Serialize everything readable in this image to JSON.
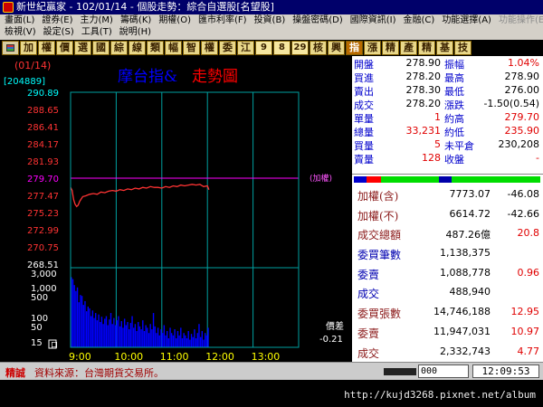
{
  "window": {
    "title": "新世紀贏家 - 102/01/14 - 個股走勢：綜合自選股[名望股]"
  },
  "menu": {
    "row1": [
      "畫面(L)",
      "證券(E)",
      "主力(M)",
      "籌碼(K)",
      "期權(O)",
      "匯市利率(F)",
      "投資(B)",
      "操盤密碼(D)",
      "國際資訊(I)",
      "金融(C)",
      "功能選擇(A)",
      "功能操作(E)"
    ],
    "row1_disabled_index": 11,
    "row2": [
      "檢視(V)",
      "設定(S)",
      "工具(T)",
      "說明(H)"
    ]
  },
  "toolbar": {
    "buttons": [
      {
        "icon": "grid-icon",
        "label": "",
        "kind": "ico"
      },
      {
        "label": "加"
      },
      {
        "label": "權"
      },
      {
        "label": "價"
      },
      {
        "label": "選"
      },
      {
        "label": "國"
      },
      {
        "label": "綜"
      },
      {
        "label": "線"
      },
      {
        "label": "類"
      },
      {
        "label": "幅"
      },
      {
        "label": "智"
      },
      {
        "label": "權"
      },
      {
        "label": "委"
      },
      {
        "label": "江"
      },
      {
        "label": "9",
        "kind": "num"
      },
      {
        "label": "8",
        "kind": "num"
      },
      {
        "label": "29",
        "kind": "num"
      },
      {
        "label": "核"
      },
      {
        "label": "興"
      },
      {
        "label": "指",
        "kind": "hl"
      },
      {
        "label": "漲"
      },
      {
        "label": "精"
      },
      {
        "label": "產"
      },
      {
        "label": "精"
      },
      {
        "label": "基"
      },
      {
        "label": "技"
      }
    ]
  },
  "chart": {
    "date_label": "(01/14)",
    "code_label": "[204889]",
    "stock_name": "摩台指&",
    "chart_title": "走勢圖",
    "ref_label": "(加權)",
    "diff_label": "價差",
    "diff_value": "-0.21",
    "volume_box_label": "口",
    "colors": {
      "up": "#ff3333",
      "down": "#00ff00",
      "flat": "#ffffff",
      "grid": "#00a0a0",
      "price_line": "#ff3333",
      "ref_line": "#ff00ff",
      "volume": "#0000ff"
    }
  },
  "chart_data": {
    "type": "line",
    "price_ticks": [
      290.89,
      288.65,
      286.41,
      284.17,
      281.93,
      279.7,
      277.47,
      275.23,
      272.99,
      270.75,
      268.51
    ],
    "reference": 279.7,
    "ylim": [
      268.51,
      290.89
    ],
    "volume_ticks": [
      "3,000",
      "1,000",
      "500",
      "100",
      "50",
      "15"
    ],
    "volume_ylim": [
      0,
      3000
    ],
    "x_ticks": [
      "9:00",
      "10:00",
      "11:00",
      "12:00",
      "13:00"
    ],
    "x_range_minutes": [
      0,
      300
    ],
    "price_series": [
      [
        0,
        278.5
      ],
      [
        2,
        278.1
      ],
      [
        4,
        276.9
      ],
      [
        6,
        276.3
      ],
      [
        8,
        276.0
      ],
      [
        10,
        276.2
      ],
      [
        12,
        276.7
      ],
      [
        14,
        277.0
      ],
      [
        16,
        277.3
      ],
      [
        20,
        277.4
      ],
      [
        25,
        277.6
      ],
      [
        30,
        277.7
      ],
      [
        35,
        277.6
      ],
      [
        40,
        277.9
      ],
      [
        45,
        277.8
      ],
      [
        50,
        278.0
      ],
      [
        55,
        278.1
      ],
      [
        60,
        278.0
      ],
      [
        65,
        278.2
      ],
      [
        70,
        278.1
      ],
      [
        75,
        278.3
      ],
      [
        80,
        278.2
      ],
      [
        85,
        278.4
      ],
      [
        90,
        278.3
      ],
      [
        95,
        278.5
      ],
      [
        100,
        278.4
      ],
      [
        105,
        278.6
      ],
      [
        110,
        278.5
      ],
      [
        115,
        278.5
      ],
      [
        120,
        278.4
      ],
      [
        125,
        278.6
      ],
      [
        130,
        278.5
      ],
      [
        135,
        278.7
      ],
      [
        140,
        278.6
      ],
      [
        145,
        278.8
      ],
      [
        150,
        278.7
      ],
      [
        155,
        278.8
      ],
      [
        160,
        278.9
      ],
      [
        165,
        278.8
      ],
      [
        170,
        278.9
      ],
      [
        175,
        278.6
      ],
      [
        180,
        278.7
      ],
      [
        182,
        278.2
      ]
    ],
    "volume_series": [
      {
        "t": 1,
        "v": 2200
      },
      {
        "t": 3,
        "v": 1900
      },
      {
        "t": 5,
        "v": 1200
      },
      {
        "t": 7,
        "v": 760
      },
      {
        "t": 9,
        "v": 1000
      },
      {
        "t": 11,
        "v": 320
      },
      {
        "t": 13,
        "v": 560
      },
      {
        "t": 15,
        "v": 520
      },
      {
        "t": 17,
        "v": 260
      },
      {
        "t": 19,
        "v": 350
      },
      {
        "t": 21,
        "v": 160
      },
      {
        "t": 23,
        "v": 230
      },
      {
        "t": 25,
        "v": 200
      },
      {
        "t": 27,
        "v": 110
      },
      {
        "t": 29,
        "v": 170
      },
      {
        "t": 31,
        "v": 95
      },
      {
        "t": 33,
        "v": 140
      },
      {
        "t": 35,
        "v": 80
      },
      {
        "t": 37,
        "v": 125
      },
      {
        "t": 39,
        "v": 70
      },
      {
        "t": 41,
        "v": 105
      },
      {
        "t": 43,
        "v": 60
      },
      {
        "t": 45,
        "v": 90
      },
      {
        "t": 47,
        "v": 110
      },
      {
        "t": 49,
        "v": 55
      },
      {
        "t": 51,
        "v": 85
      },
      {
        "t": 53,
        "v": 140
      },
      {
        "t": 55,
        "v": 60
      },
      {
        "t": 57,
        "v": 95
      },
      {
        "t": 59,
        "v": 55
      },
      {
        "t": 61,
        "v": 80
      },
      {
        "t": 63,
        "v": 110
      },
      {
        "t": 65,
        "v": 50
      },
      {
        "t": 67,
        "v": 75
      },
      {
        "t": 69,
        "v": 45
      },
      {
        "t": 71,
        "v": 90
      },
      {
        "t": 73,
        "v": 55
      },
      {
        "t": 75,
        "v": 70
      },
      {
        "t": 77,
        "v": 40
      },
      {
        "t": 79,
        "v": 65
      },
      {
        "t": 81,
        "v": 110
      },
      {
        "t": 83,
        "v": 45
      },
      {
        "t": 85,
        "v": 60
      },
      {
        "t": 87,
        "v": 35
      },
      {
        "t": 89,
        "v": 70
      },
      {
        "t": 91,
        "v": 50
      },
      {
        "t": 93,
        "v": 40
      },
      {
        "t": 95,
        "v": 80
      },
      {
        "t": 97,
        "v": 35
      },
      {
        "t": 99,
        "v": 55
      },
      {
        "t": 101,
        "v": 45
      },
      {
        "t": 103,
        "v": 30
      },
      {
        "t": 105,
        "v": 60
      },
      {
        "t": 107,
        "v": 40
      },
      {
        "t": 109,
        "v": 140
      },
      {
        "t": 111,
        "v": 50
      },
      {
        "t": 113,
        "v": 30
      },
      {
        "t": 115,
        "v": 45
      },
      {
        "t": 117,
        "v": 25
      },
      {
        "t": 119,
        "v": 40
      },
      {
        "t": 121,
        "v": 30
      },
      {
        "t": 123,
        "v": 55
      },
      {
        "t": 125,
        "v": 25
      },
      {
        "t": 127,
        "v": 35
      },
      {
        "t": 129,
        "v": 20
      },
      {
        "t": 131,
        "v": 45
      },
      {
        "t": 133,
        "v": 30
      },
      {
        "t": 135,
        "v": 25
      },
      {
        "t": 137,
        "v": 40
      },
      {
        "t": 139,
        "v": 20
      },
      {
        "t": 141,
        "v": 35
      },
      {
        "t": 143,
        "v": 25
      },
      {
        "t": 145,
        "v": 45
      },
      {
        "t": 147,
        "v": 20
      },
      {
        "t": 149,
        "v": 30
      },
      {
        "t": 151,
        "v": 25
      },
      {
        "t": 153,
        "v": 20
      },
      {
        "t": 155,
        "v": 35
      },
      {
        "t": 157,
        "v": 18
      },
      {
        "t": 159,
        "v": 28
      },
      {
        "t": 161,
        "v": 22
      },
      {
        "t": 163,
        "v": 40
      },
      {
        "t": 165,
        "v": 20
      },
      {
        "t": 167,
        "v": 30
      },
      {
        "t": 169,
        "v": 60
      },
      {
        "t": 171,
        "v": 22
      },
      {
        "t": 173,
        "v": 35
      },
      {
        "t": 175,
        "v": 18
      },
      {
        "t": 177,
        "v": 30
      },
      {
        "t": 179,
        "v": 25
      },
      {
        "t": 181,
        "v": 45
      }
    ]
  },
  "quote": {
    "rows": [
      {
        "l1": "開盤",
        "v1": "278.90",
        "l2": "振幅",
        "v2": "1.04%",
        "c2": "red"
      },
      {
        "l1": "買進",
        "v1": "278.20",
        "l2": "最高",
        "v2": "278.90",
        "c2": "blk"
      },
      {
        "l1": "賣出",
        "v1": "278.30",
        "l2": "最低",
        "v2": "276.00",
        "c2": "blk"
      },
      {
        "l1": "成交",
        "v1": "278.20",
        "l2": "漲跌",
        "v2": "-1.50(0.54)",
        "c2": "blk"
      },
      {
        "l1": "單量",
        "v1": "1",
        "c1": "red",
        "l2": "約高",
        "v2": "279.70",
        "c2": "red"
      },
      {
        "l1": "總量",
        "v1": "33,231",
        "c1": "red",
        "l2": "約低",
        "v2": "235.90",
        "c2": "red"
      },
      {
        "l1": "買量",
        "v1": "5",
        "c1": "red",
        "l2": "未平倉",
        "v2": "230,208",
        "c2": "blk"
      },
      {
        "l1": "賣量",
        "v1": "128",
        "c1": "red",
        "l2": "收盤",
        "v2": "-",
        "c2": "red"
      }
    ]
  },
  "index_panel": {
    "rows": [
      {
        "label": "加權(含)",
        "v1": "7773.07",
        "v2": "-46.08",
        "c2": "blk"
      },
      {
        "label": "加權(不)",
        "v1": "6614.72",
        "v2": "-42.66",
        "c2": "blk"
      },
      {
        "label": "成交總額",
        "v1": "487.26億",
        "v2": "20.8",
        "c2": "red"
      },
      {
        "label": "委買筆數",
        "v1": "1,138,375",
        "v2": "",
        "c2": "blk",
        "lc": "b"
      },
      {
        "label": "委賣",
        "v1": "1,088,778",
        "v2": "0.96",
        "c2": "red",
        "lc": "b"
      },
      {
        "label": "成交",
        "v1": "488,940",
        "v2": "",
        "c2": "blk",
        "lc": "b"
      },
      {
        "label": "委買張數",
        "v1": "14,746,188",
        "v2": "12.95",
        "c2": "red"
      },
      {
        "label": "委賣",
        "v1": "11,947,031",
        "v2": "10.97",
        "c2": "red"
      },
      {
        "label": "成交",
        "v1": "2,332,743",
        "v2": "4.77",
        "c2": "red"
      }
    ]
  },
  "status": {
    "tag": "精誠",
    "source": "資料來源：台灣期貨交易所。",
    "code_input": "000",
    "clock": "12:09:53"
  },
  "footer": {
    "watermark": "http://kujd3268.pixnet.net/album"
  }
}
